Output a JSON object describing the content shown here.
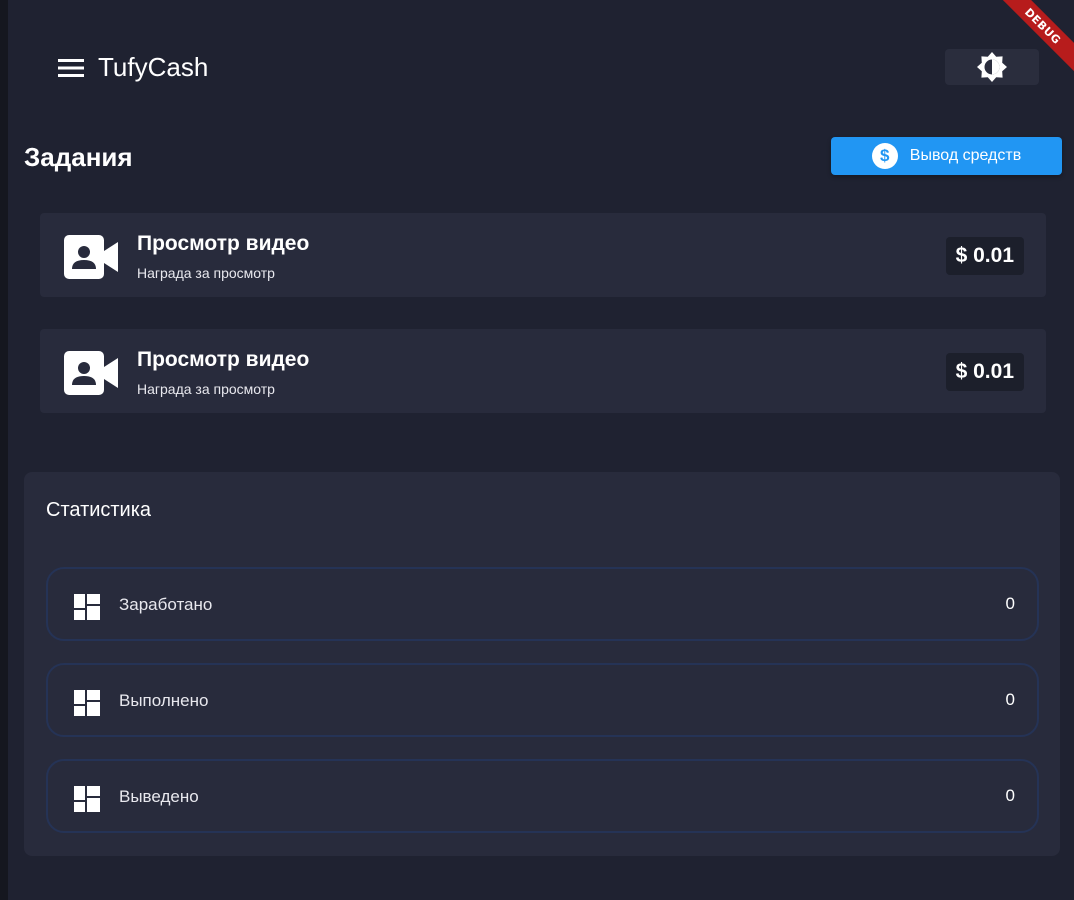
{
  "debug_banner": "DEBUG",
  "header": {
    "title": "TufyCash",
    "menu_icon": "menu-icon",
    "theme_icon": "brightness-icon"
  },
  "tasks": {
    "title": "Задания",
    "withdraw_button": {
      "label": "Вывод средств",
      "icon": "dollar-coin-icon"
    },
    "items": [
      {
        "title": "Просмотр видео",
        "subtitle": "Награда за просмотр",
        "reward": "$ 0.01",
        "icon": "video-account-icon"
      },
      {
        "title": "Просмотр видео",
        "subtitle": "Награда за просмотр",
        "reward": "$ 0.01",
        "icon": "video-account-icon"
      }
    ]
  },
  "stats": {
    "title": "Статистика",
    "rows": [
      {
        "label": "Заработано",
        "value": "0",
        "icon": "dashboard-icon"
      },
      {
        "label": "Выполнено",
        "value": "0",
        "icon": "dashboard-icon"
      },
      {
        "label": "Выведено",
        "value": "0",
        "icon": "dashboard-icon"
      }
    ]
  },
  "colors": {
    "background": "#1f2231",
    "card": "#282b3c",
    "accent": "#2196f3",
    "debug": "#b71c1c",
    "stat_border": "#253356"
  }
}
